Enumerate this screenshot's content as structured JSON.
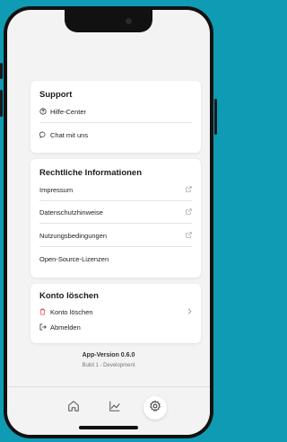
{
  "colors": {
    "background": "#0f9bb3",
    "danger": "#e0454b",
    "text": "#1c1c1c",
    "muted": "#9a9a9a"
  },
  "support": {
    "title": "Support",
    "items": [
      {
        "label": "Hilfe-Center",
        "icon": "help-circle-icon"
      },
      {
        "label": "Chat mit uns",
        "icon": "chat-bubble-icon"
      }
    ]
  },
  "legal": {
    "title": "Rechtliche Informationen",
    "items": [
      {
        "label": "Impressum",
        "icon": "external-link-icon"
      },
      {
        "label": "Datenschutzhinweise",
        "icon": "external-link-icon"
      },
      {
        "label": "Nutzungsbedingungen",
        "icon": "external-link-icon"
      },
      {
        "label": "Open-Source-Lizenzen"
      }
    ]
  },
  "account": {
    "title": "Konto löschen",
    "items": [
      {
        "label": "Konto löschen",
        "icon": "trash-icon"
      },
      {
        "label": "Abmelden",
        "icon": "logout-icon"
      }
    ]
  },
  "version": {
    "app": "App-Version 0.6.0",
    "build": "Build 1 - Development"
  },
  "tabbar": {
    "tabs": [
      {
        "name": "home",
        "icon": "home-icon"
      },
      {
        "name": "stats",
        "icon": "chart-icon"
      },
      {
        "name": "settings",
        "icon": "gear-icon",
        "active": true
      }
    ]
  }
}
